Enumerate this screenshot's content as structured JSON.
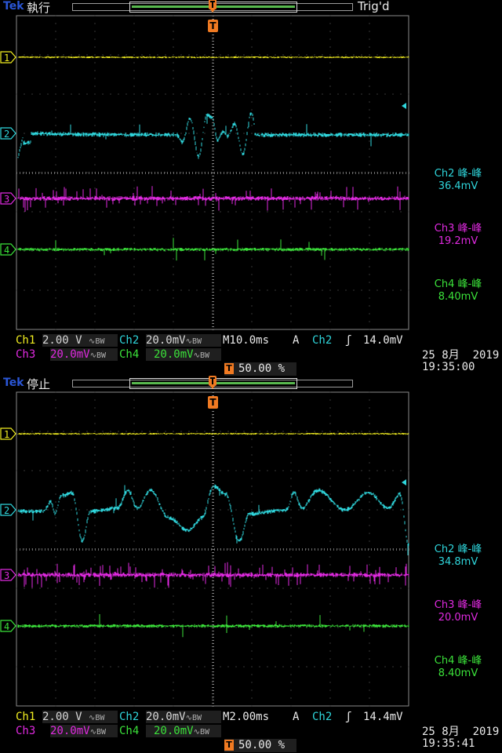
{
  "brand": "Tek",
  "panels": [
    {
      "mode": "執行",
      "trig_status": "Trig'd",
      "ch_markers": [
        "1",
        "2",
        "3",
        "4"
      ],
      "measurements": [
        {
          "label": "Ch2 峰-峰",
          "value": "36.4mV"
        },
        {
          "label": "Ch3 峰-峰",
          "value": "19.2mV"
        },
        {
          "label": "Ch4 峰-峰",
          "value": "8.40mV"
        }
      ],
      "settings": {
        "ch1_label": "Ch1",
        "ch1_scale": "2.00 V",
        "ch2_label": "Ch2",
        "ch2_scale": "20.0mV",
        "ch3_label": "Ch3",
        "ch3_scale": "20.0mV",
        "ch4_label": "Ch4",
        "ch4_scale": "20.0mV",
        "bw_icon": "∿BW",
        "timebase": "M10.0ms",
        "acq": "A",
        "trig_source": "Ch2",
        "trig_slope": "ʃ",
        "trig_level": "14.0mV",
        "trig_pos": "50.00 %",
        "t_marker": "T"
      },
      "date": "25 8月  2019",
      "time": "19:35:00"
    },
    {
      "mode": "停止",
      "trig_status": "",
      "ch_markers": [
        "1",
        "2",
        "3",
        "4"
      ],
      "measurements": [
        {
          "label": "Ch2 峰-峰",
          "value": "34.8mV"
        },
        {
          "label": "Ch3 峰-峰",
          "value": "20.0mV"
        },
        {
          "label": "Ch4 峰-峰",
          "value": "8.40mV"
        }
      ],
      "settings": {
        "ch1_label": "Ch1",
        "ch1_scale": "2.00 V",
        "ch2_label": "Ch2",
        "ch2_scale": "20.0mV",
        "ch3_label": "Ch3",
        "ch3_scale": "20.0mV",
        "ch4_label": "Ch4",
        "ch4_scale": "20.0mV",
        "bw_icon": "∿BW",
        "timebase": "M2.00ms",
        "acq": "A",
        "trig_source": "Ch2",
        "trig_slope": "ʃ",
        "trig_level": "14.4mV",
        "trig_pos": "50.00 %",
        "t_marker": "T"
      },
      "date": "25 8月  2019",
      "time": "19:35:41"
    }
  ],
  "colors": {
    "ch1": "#f2ee20",
    "ch2": "#2fd6dc",
    "ch3": "#e02ae0",
    "ch4": "#3be23a",
    "grid": "#6b6b6b",
    "trigger": "#f07a22"
  }
}
